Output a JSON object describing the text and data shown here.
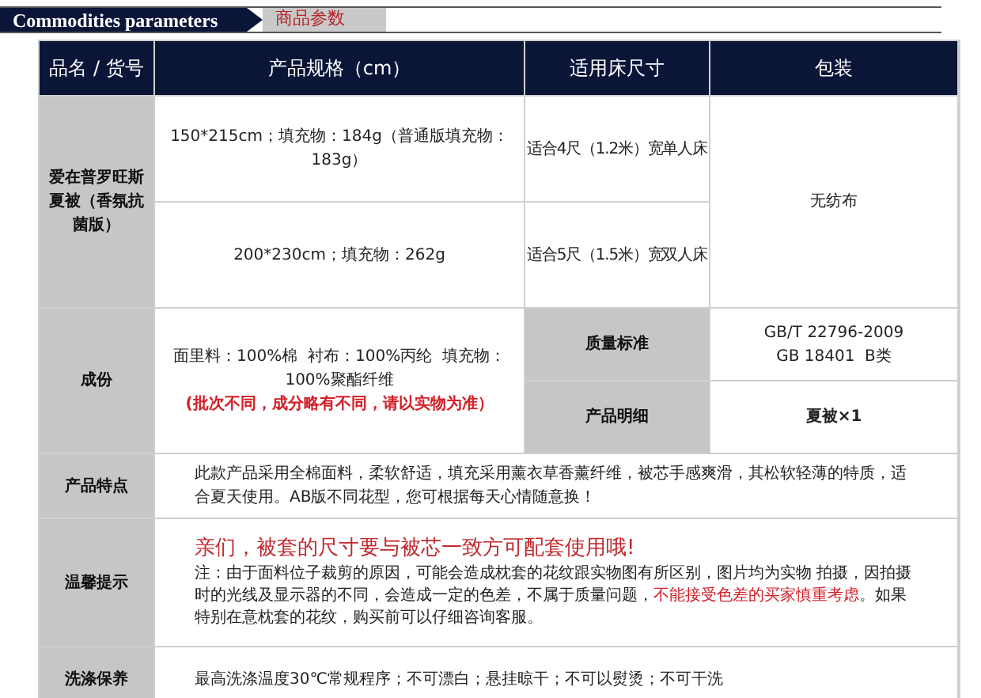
{
  "header": {
    "title_en": "Commodities parameters",
    "title_zh": "商品参数"
  },
  "table": {
    "columns": [
      "品名 / 货号",
      "产品规格（cm）",
      "适用床尺寸",
      "包装"
    ],
    "product": {
      "name": "爱在普罗旺斯夏被（香氛抗菌版）",
      "packaging": "无纺布",
      "variants": [
        {
          "spec": "150*215cm；填充物：184g（普通版填充物：183g）",
          "bed": "适合4尺（1.2米）宽单人床"
        },
        {
          "spec": "200*230cm；填充物：262g",
          "bed": "适合5尺（1.5米）宽双人床"
        }
      ]
    },
    "composition": {
      "label": "成份",
      "text": "面里料：100%棉  衬布：100%丙纶  填充物：100%聚酯纤维",
      "note": "(批次不同，成分略有不同，请以实物为准）",
      "details": [
        {
          "label": "质量标准",
          "lines": [
            "GB/T 22796-2009",
            "GB 18401  B类"
          ],
          "bold": false
        },
        {
          "label": "产品明细",
          "lines": [
            "夏被×1"
          ],
          "bold": true
        }
      ]
    },
    "features": {
      "label": "产品特点",
      "text": "此款产品采用全棉面料，柔软舒适，填充采用薰衣草香薰纤维，被芯手感爽滑，其松软轻薄的特质，适合夏天使用。AB版不同花型，您可根据每天心情随意换！"
    },
    "tips": {
      "label": "温馨提示",
      "headline": "亲们，被套的尺寸要与被芯一致方可配套使用哦!",
      "note": [
        {
          "text": "注：由于面料位子裁剪的原因，可能会造成枕套的花纹跟实物图有所区别，图片均为实物 拍摄，因拍摄时的光线及显示器的不同，会造成一定的色差，不属于质量问题，",
          "highlight": false
        },
        {
          "text": "不能接受色差的买家慎重考虑",
          "highlight": true
        },
        {
          "text": "。如果特别在意枕套的花纹，购买前可以仔细咨询客服。",
          "highlight": false
        }
      ]
    },
    "care": {
      "label": "洗涤保养",
      "text": "最高洗涤温度30℃常规程序；不可漂白；悬挂晾干；不可以熨烫；不可干洗"
    }
  }
}
